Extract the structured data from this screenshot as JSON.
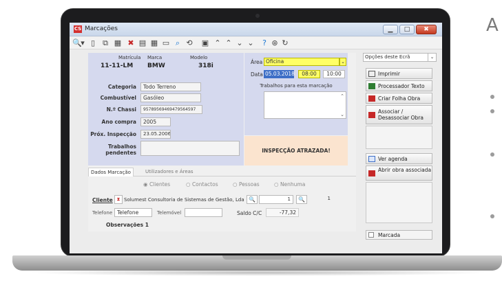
{
  "window": {
    "title": "Marcações",
    "app_icon": "CS",
    "controls": {
      "min": "▁",
      "max": "□",
      "close": "✖"
    }
  },
  "toolbar": {
    "icons": [
      "search-icon",
      "dropdown-arrow-icon",
      "new-doc-icon",
      "copy-doc-icon",
      "calendar-icon",
      "delete-icon",
      "table-icon",
      "grid-icon",
      "form-icon",
      "find-icon",
      "refresh-icon",
      "print-preview-icon",
      "chevron-first-icon",
      "chevron-up-icon",
      "chevron-down-icon",
      "chevron-last-icon",
      "help-icon",
      "settings-icon",
      "rotate-icon"
    ],
    "glyphs": [
      "🔍",
      "▾",
      "▯",
      "⧉",
      "▦",
      "✖",
      "▤",
      "▦",
      "▭",
      "⌕",
      "⟲",
      "▣",
      "⌃",
      "⌃",
      "⌄",
      "⌄",
      "?",
      "⊛",
      "↻"
    ]
  },
  "vehicle": {
    "matricula_label": "Matrícula",
    "matricula": "11-11-LM",
    "marca_label": "Marca",
    "marca": "BMW",
    "modelo_label": "Modelo",
    "modelo": "318i"
  },
  "props": {
    "categoria_label": "Categoria",
    "categoria": "Todo Terreno",
    "combustivel_label": "Combustível",
    "combustivel": "Gasóleo",
    "chassi_label": "N.º Chassi",
    "chassi": "95789569469479564597",
    "ano_label": "Ano compra",
    "ano": "2005",
    "inspecao_label": "Próx. Inspecção",
    "inspecao": "23.05.2006",
    "trabalhos_label": "Trabalhos pendentes",
    "trabalhos": ""
  },
  "area": {
    "area_label": "Área",
    "area_value": "Oficina",
    "data_label": "Data",
    "date": "05.03.2018",
    "time_from": "08:00",
    "time_to": "10:00",
    "trabalhos_label": "Trabalhos para esta marcação"
  },
  "warning": "INSPECÇÃO ATRAZADA!",
  "tabs": [
    "Dados Marcação",
    "Utilizadores e Áreas"
  ],
  "radio": [
    "Clientes",
    "Contactos",
    "Pessoas",
    "Nenhuma"
  ],
  "cliente": {
    "label": "Cliente",
    "name": "Solumest Consultoria de Sistemas de Gestão, Lda",
    "num1": "1",
    "num2": "1"
  },
  "contacts": {
    "telefone_label": "Telefone",
    "telefone_value": "Telefone",
    "telemovel_label": "Telemóvel",
    "telemovel_value": "",
    "saldo_label": "Saldo C/C",
    "saldo_value": "-77,32"
  },
  "observacoes": "Observações 1",
  "right": {
    "options_label": "Opções deste Ecrã",
    "imprimir": "Imprimir",
    "processador": "Processador Texto",
    "criar_folha": "Criar Folha Obra",
    "associar": "Associar / Desassociar Obra",
    "ver_agenda": "Ver agenda",
    "abrir_obra": "Abrir obra associada",
    "marcada": "Marcada"
  },
  "colors": {
    "accent": "#3e6fc7",
    "yellow": "#ffff66",
    "warning_bg": "#fbe4cf",
    "panel": "#d5d9ee"
  }
}
